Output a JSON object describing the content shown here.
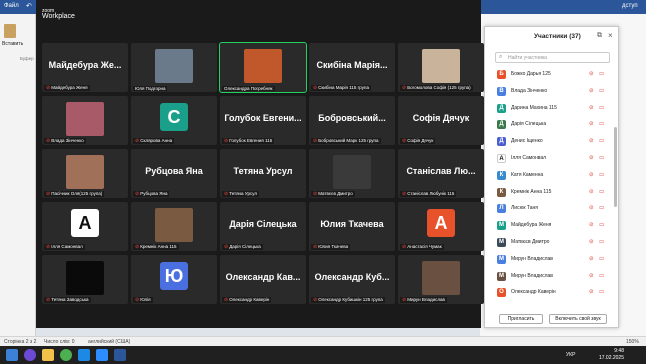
{
  "word": {
    "menu_file": "Файл",
    "paste_label": "Вставить",
    "clipboard_label": "Буфер",
    "share_label": "дступ",
    "status_page": "Сторінка 2 з 2",
    "status_words": "Число слів: 0",
    "status_lang": "английский (США)",
    "zoom": "150%"
  },
  "zoom_app": {
    "logo_line1": "zoom",
    "logo_line2": "Workplace"
  },
  "tiles": [
    {
      "big": "Майдебура Же...",
      "name": "Майдебура Женя",
      "muted": true
    },
    {
      "big": "",
      "name": "Юля Подгорна",
      "muted": false,
      "photo": "#6a7a8a"
    },
    {
      "big": "",
      "name": "Олександра Погребняк",
      "muted": false,
      "photo": "#c0582c",
      "active": true
    },
    {
      "big": "Скибіна Марія...",
      "name": "Скибіна Марія 115 група",
      "muted": true
    },
    {
      "big": "",
      "name": "Богомолова Софія (125 група)",
      "muted": true,
      "photo": "#c9b39a"
    },
    {
      "big": "",
      "name": "Влада Зінченко",
      "muted": true,
      "photo": "#a85a68"
    },
    {
      "big": "",
      "name": "Склярова Анна",
      "muted": true,
      "avatar": "C",
      "avatar_color": "#1aa08a"
    },
    {
      "big": "Голубок Евгени...",
      "name": "Голубок Евгения 115",
      "muted": true
    },
    {
      "big": "Бобровський...",
      "name": "Бобровський Марк 125 група",
      "muted": true
    },
    {
      "big": "Софія Дячук",
      "name": "Софія Дячук",
      "muted": true
    },
    {
      "big": "",
      "name": "Пасічник Оля(125 група)",
      "muted": true,
      "photo": "#a07058"
    },
    {
      "big": "Рубцова Яна",
      "name": "Рубцова Яна",
      "muted": true
    },
    {
      "big": "Тетяна Урсул",
      "name": "Тетяна Урсул",
      "muted": true
    },
    {
      "big": "",
      "name": "Матвєєв Дмитро",
      "muted": true,
      "photo": "#3a3a3a"
    },
    {
      "big": "Станіслав Лю...",
      "name": "Станіслав Любунік 115",
      "muted": true
    },
    {
      "big": "",
      "name": "Ілля Самонвал",
      "muted": true,
      "avatar": "A",
      "avatar_color": "#ffffff"
    },
    {
      "big": "",
      "name": "Кремнік Анна 115",
      "muted": true,
      "photo": "#7a5a40"
    },
    {
      "big": "Дарія Сілецька",
      "name": "Дарія Сілецька",
      "muted": true
    },
    {
      "big": "Юлия Ткачева",
      "name": "Юлия Ткачева",
      "muted": true
    },
    {
      "big": "",
      "name": "Анастасія Чумак",
      "muted": true,
      "avatar": "A",
      "avatar_color": "#e8522b"
    },
    {
      "big": "",
      "name": "Тетяна Заводська",
      "muted": true,
      "photo": "#0a0a0a"
    },
    {
      "big": "",
      "name": "Юлія",
      "muted": true,
      "avatar": "Ю",
      "avatar_color": "#4a6fe0"
    },
    {
      "big": "Олександр Кав...",
      "name": "Олександр Каверін",
      "muted": true
    },
    {
      "big": "Олександр Куб...",
      "name": "Олександр Кубишкін 125 група",
      "muted": true
    },
    {
      "big": "",
      "name": "Мирун Владислав",
      "muted": true,
      "photo": "#6a5040"
    }
  ],
  "participants_panel": {
    "title": "Участники (37)",
    "search_placeholder": "Найти участника",
    "invite_button": "Пригласить",
    "unmute_button": "Включить свой звук",
    "participants": [
      {
        "initial": "Б",
        "color": "#e8522b",
        "name": "Божко Дарья 125"
      },
      {
        "initial": "В",
        "color": "#4a7fe0",
        "name": "Влада Зінченко"
      },
      {
        "initial": "Д",
        "color": "#1aa08a",
        "name": "Дарина Махина 115"
      },
      {
        "initial": "Д",
        "color": "#3a7a4a",
        "name": "Дарія Сілецька"
      },
      {
        "initial": "Д",
        "color": "#4a5fd0",
        "name": "Денис Іщенко"
      },
      {
        "initial": "A",
        "color": "#ffffff",
        "name": "Ілля Самонвал"
      },
      {
        "initial": "К",
        "color": "#3a8ad0",
        "name": "Катя Каменна"
      },
      {
        "initial": "К",
        "color": "#7a5a40",
        "name": "Кремнік Анна 115"
      },
      {
        "initial": "Л",
        "color": "#4a7fe0",
        "name": "Лисюк Таня"
      },
      {
        "initial": "М",
        "color": "#1aa08a",
        "name": "Майдебура Женя"
      },
      {
        "initial": "М",
        "color": "#3a4a5a",
        "name": "Матвєєв Дмитро"
      },
      {
        "initial": "М",
        "color": "#4a7fe0",
        "name": "Мирун Владислав"
      },
      {
        "initial": "М",
        "color": "#6a5040",
        "name": "Мирун Владислав"
      },
      {
        "initial": "О",
        "color": "#e8522b",
        "name": "Олександр Каверін"
      }
    ]
  },
  "system": {
    "lang": "УКР",
    "time": "9:48",
    "date": "17.02.2025"
  }
}
